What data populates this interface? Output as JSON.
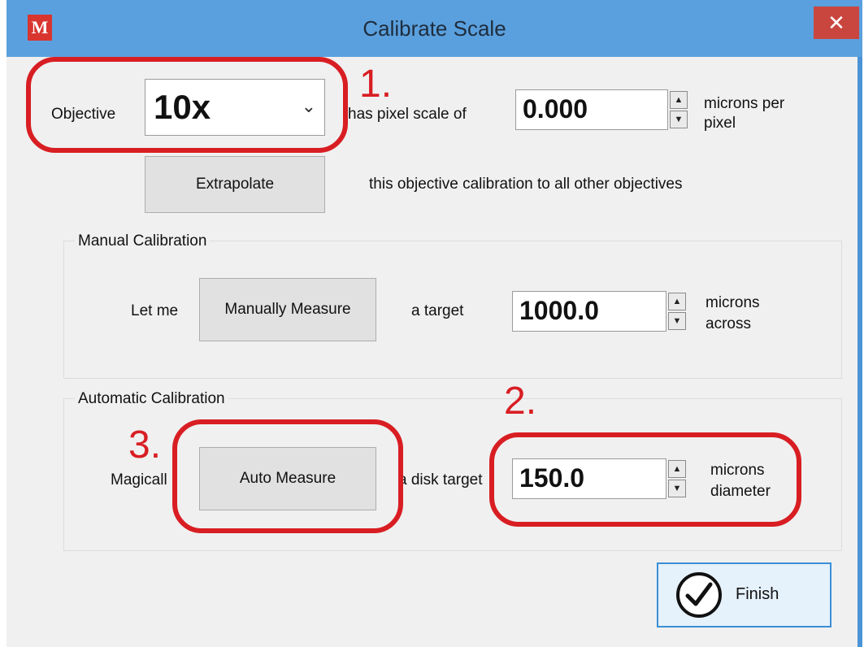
{
  "window": {
    "title": "Calibrate Scale",
    "app_icon": "M",
    "close_glyph": "✕"
  },
  "objective": {
    "label": "Objective",
    "value": "10x",
    "suffix": "has pixel scale of"
  },
  "pixel_scale": {
    "value": "0.000",
    "unit": [
      "microns per",
      "pixel"
    ]
  },
  "extrapolate": {
    "button": "Extrapolate",
    "description": "this objective calibration to all other objectives"
  },
  "manual": {
    "group_title": "Manual Calibration",
    "prefix": "Let me",
    "button": "Manually Measure",
    "middle": "a target",
    "value": "1000.0",
    "unit": [
      "microns",
      "across"
    ]
  },
  "automatic": {
    "group_title": "Automatic Calibration",
    "prefix": "Magicall",
    "button": "Auto Measure",
    "middle": "a disk target",
    "value": "150.0",
    "unit": [
      "microns",
      "diameter"
    ]
  },
  "finish": {
    "label": "Finish"
  },
  "annotations": {
    "n1": "1.",
    "n2": "2.",
    "n3": "3."
  },
  "colors": {
    "annotation_red": "#d81e23",
    "title_bar": "#5aa0de",
    "close": "#c9463f"
  }
}
